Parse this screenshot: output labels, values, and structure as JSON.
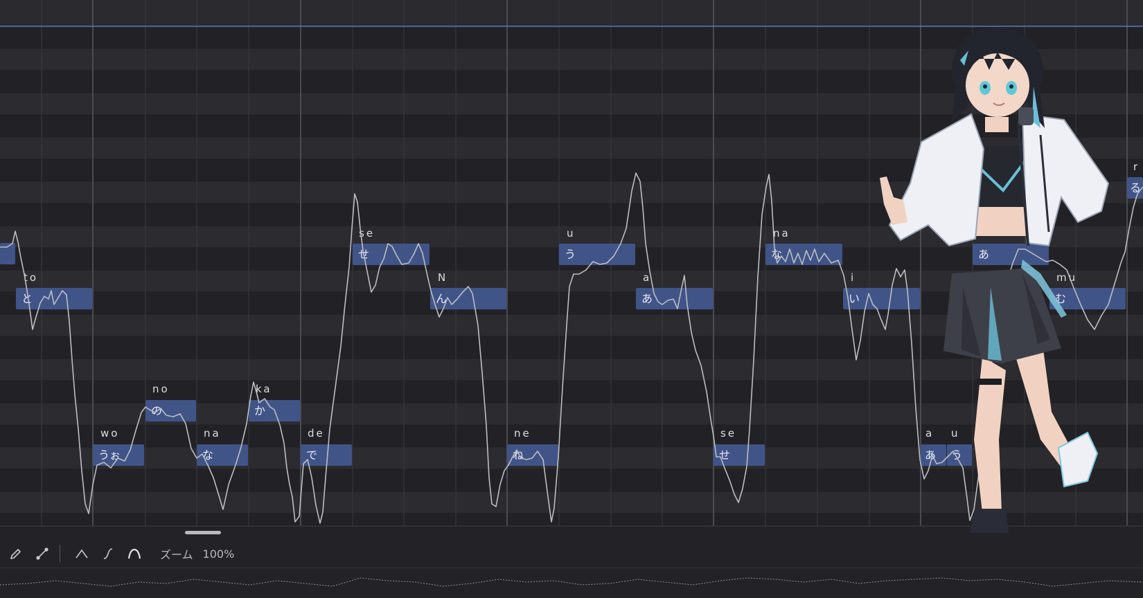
{
  "notes": [
    {
      "lyric": "",
      "phoneme": ""
    },
    {
      "lyric": "と",
      "phoneme": "to"
    },
    {
      "lyric": "うぉ",
      "phoneme": "wo"
    },
    {
      "lyric": "の",
      "phoneme": "no"
    },
    {
      "lyric": "な",
      "phoneme": "na"
    },
    {
      "lyric": "か",
      "phoneme": "ka"
    },
    {
      "lyric": "で",
      "phoneme": "de"
    },
    {
      "lyric": "せ",
      "phoneme": "se"
    },
    {
      "lyric": "ん",
      "phoneme": "N"
    },
    {
      "lyric": "ね",
      "phoneme": "ne"
    },
    {
      "lyric": "う",
      "phoneme": "u"
    },
    {
      "lyric": "あ",
      "phoneme": "a"
    },
    {
      "lyric": "せ",
      "phoneme": "se"
    },
    {
      "lyric": "な",
      "phoneme": "na"
    },
    {
      "lyric": "い",
      "phoneme": "i"
    },
    {
      "lyric": "あ",
      "phoneme": "a"
    },
    {
      "lyric": "う",
      "phoneme": "u"
    },
    {
      "lyric": "あ",
      "phoneme": ""
    },
    {
      "lyric": "む",
      "phoneme": "mu"
    },
    {
      "lyric": "る",
      "phoneme": "r"
    }
  ],
  "toolbar": {
    "tools": [
      {
        "icon": "pencil-icon"
      },
      {
        "icon": "line-tool-icon"
      },
      {
        "icon": "curve-peak-icon"
      },
      {
        "icon": "curve-s-icon"
      },
      {
        "icon": "curve-arch-icon"
      }
    ],
    "zoom_label": "ズーム",
    "zoom_value": "100%"
  },
  "colors": {
    "background": "#26262b",
    "lane_dark": "#222226",
    "lane_light": "#2b2b30",
    "note_fill": "#415488",
    "pitch_line": "#bdbdc3",
    "accent_line": "#5f78c0"
  }
}
